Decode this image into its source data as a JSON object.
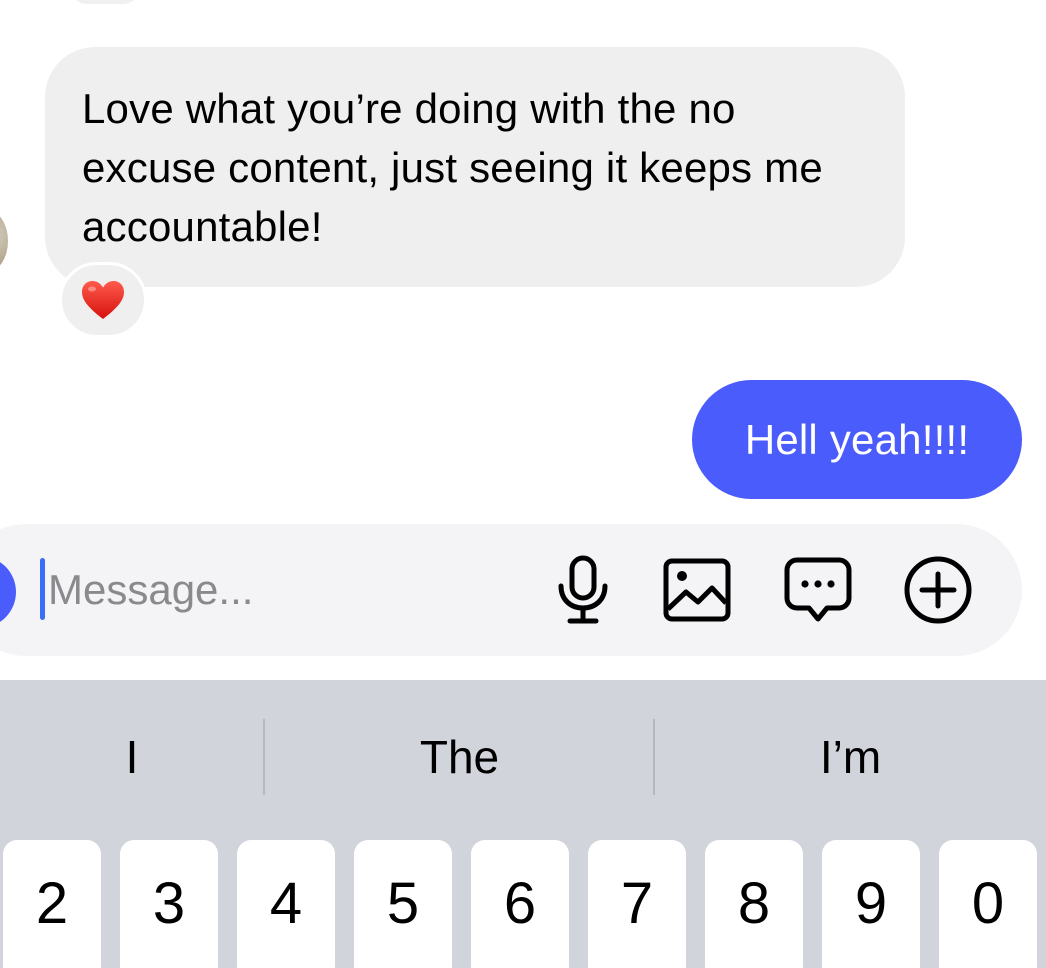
{
  "conversation": {
    "incoming": {
      "text": "Love what you’re doing with the no excuse content, just seeing it keeps me accountable!",
      "reaction": "❤️"
    },
    "outgoing": {
      "text": "Hell yeah!!!!"
    }
  },
  "composer": {
    "placeholder": "Message...",
    "tools": [
      "microphone-icon",
      "photo-icon",
      "sticker-chat-icon",
      "plus-circle-icon"
    ],
    "accent_color": "#4a5cfb"
  },
  "keyboard": {
    "suggestions": [
      "I",
      "The",
      "I’m"
    ],
    "number_keys": [
      "2",
      "3",
      "4",
      "5",
      "6",
      "7",
      "8",
      "9",
      "0"
    ]
  }
}
